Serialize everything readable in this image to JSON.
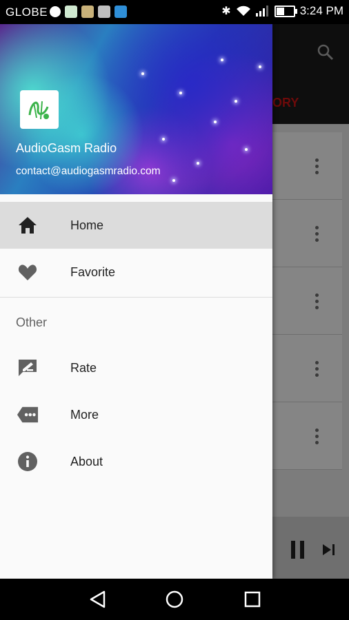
{
  "status_bar": {
    "carrier": "GLOBE",
    "time": "3:24 PM"
  },
  "drawer": {
    "app_name": "AudioGasm Radio",
    "email": "contact@audiogasmradio.com",
    "items": [
      {
        "label": "Home",
        "icon": "home-icon",
        "selected": true
      },
      {
        "label": "Favorite",
        "icon": "heart-icon",
        "selected": false
      }
    ],
    "section_title": "Other",
    "other_items": [
      {
        "label": "Rate",
        "icon": "rate-icon"
      },
      {
        "label": "More",
        "icon": "more-icon"
      },
      {
        "label": "About",
        "icon": "info-icon"
      }
    ]
  },
  "background_app": {
    "tab_fragment": "ORY"
  },
  "colors": {
    "drawer_bg": "#fafafa",
    "selected_bg": "#dcdcdc",
    "icon_color": "#616161",
    "accent_tab": "#8b0000"
  }
}
